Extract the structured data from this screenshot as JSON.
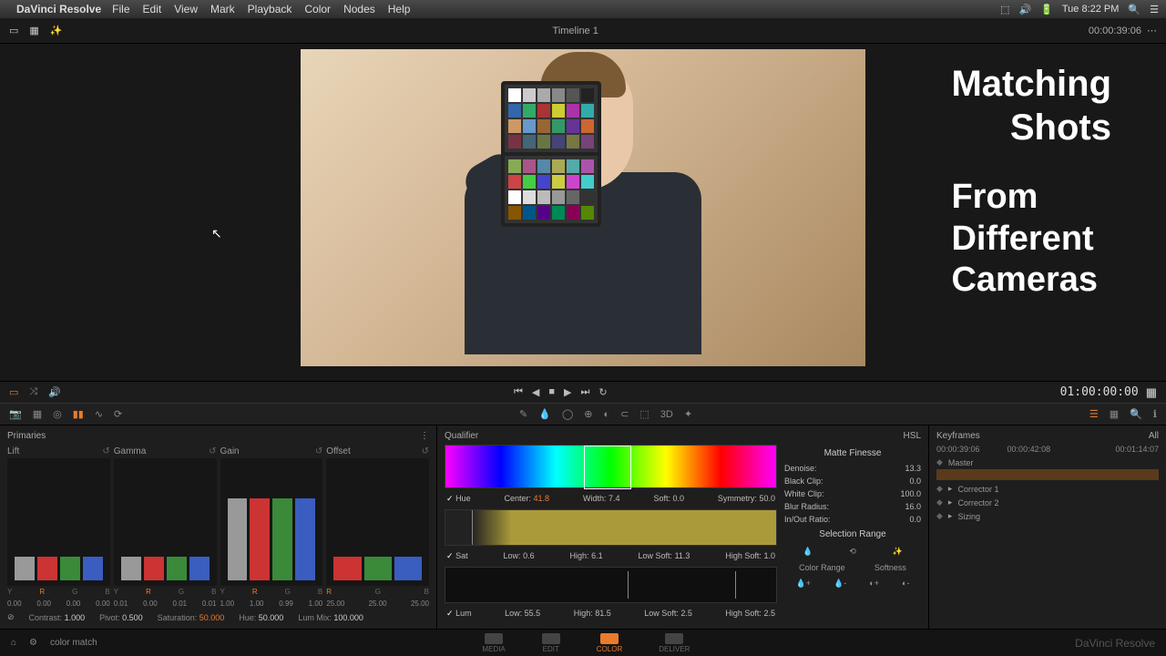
{
  "menubar": {
    "app": "DaVinci Resolve",
    "items": [
      "File",
      "Edit",
      "View",
      "Mark",
      "Playback",
      "Color",
      "Nodes",
      "Help"
    ],
    "clock": "Tue 8:22 PM"
  },
  "topbar": {
    "timeline": "Timeline 1",
    "timecode": "00:00:39:06"
  },
  "overlay": {
    "l1": "Matching",
    "l2": "Shots",
    "l3": "From",
    "l4": "Different",
    "l5": "Cameras"
  },
  "transport": {
    "big_tc": "01:00:00:00"
  },
  "qualifier": {
    "title": "Qualifier",
    "mode": "HSL",
    "hue": {
      "label": "Hue",
      "center_l": "Center:",
      "center": "41.8",
      "width_l": "Width:",
      "width": "7.4",
      "soft_l": "Soft:",
      "soft": "0.0",
      "sym_l": "Symmetry:",
      "sym": "50.0"
    },
    "sat": {
      "label": "Sat",
      "low_l": "Low:",
      "low": "0.6",
      "high_l": "High:",
      "high": "6.1",
      "ls_l": "Low Soft:",
      "ls": "11.3",
      "hs_l": "High Soft:",
      "hs": "1.0"
    },
    "lum": {
      "label": "Lum",
      "low_l": "Low:",
      "low": "55.5",
      "high_l": "High:",
      "high": "81.5",
      "ls_l": "Low Soft:",
      "ls": "2.5",
      "hs_l": "High Soft:",
      "hs": "2.5"
    },
    "finesse": {
      "title": "Matte Finesse",
      "denoise_l": "Denoise:",
      "denoise": "13.3",
      "bc_l": "Black Clip:",
      "bc": "0.0",
      "wc_l": "White Clip:",
      "wc": "100.0",
      "br_l": "Blur Radius:",
      "br": "16.0",
      "io_l": "In/Out Ratio:",
      "io": "0.0",
      "range": "Selection Range",
      "cr": "Color Range",
      "soft": "Softness"
    }
  },
  "primaries": {
    "title": "Primaries",
    "lift": {
      "label": "Lift",
      "y": "0.00",
      "r": "0.00",
      "g": "0.00",
      "b": "0.00"
    },
    "gamma": {
      "label": "Gamma",
      "y": "0.01",
      "r": "0.00",
      "g": "0.01",
      "b": "0.01"
    },
    "gain": {
      "label": "Gain",
      "y": "1.00",
      "r": "1.00",
      "g": "0.99",
      "b": "1.00"
    },
    "offset": {
      "label": "Offset",
      "r": "25.00",
      "g": "25.00",
      "b": "25.00"
    },
    "footer": {
      "contrast_l": "Contrast:",
      "contrast": "1.000",
      "pivot_l": "Pivot:",
      "pivot": "0.500",
      "sat_l": "Saturation:",
      "sat": "50.000",
      "hue_l": "Hue:",
      "hue": "50.000",
      "lm_l": "Lum Mix:",
      "lm": "100.000"
    }
  },
  "keyframes": {
    "title": "Keyframes",
    "all": "All",
    "tc1": "00:00:39:06",
    "tc2": "00:00:42:08",
    "tc3": "00:01:14:07",
    "master": "Master",
    "c1": "Corrector 1",
    "c2": "Corrector 2",
    "sizing": "Sizing"
  },
  "pages": {
    "media": "MEDIA",
    "edit": "EDIT",
    "color": "COLOR",
    "deliver": "DELIVER"
  },
  "footer": {
    "project": "color match",
    "brand": "DaVinci Resolve"
  },
  "channels": {
    "y": "Y",
    "r": "R",
    "g": "G",
    "b": "B"
  }
}
